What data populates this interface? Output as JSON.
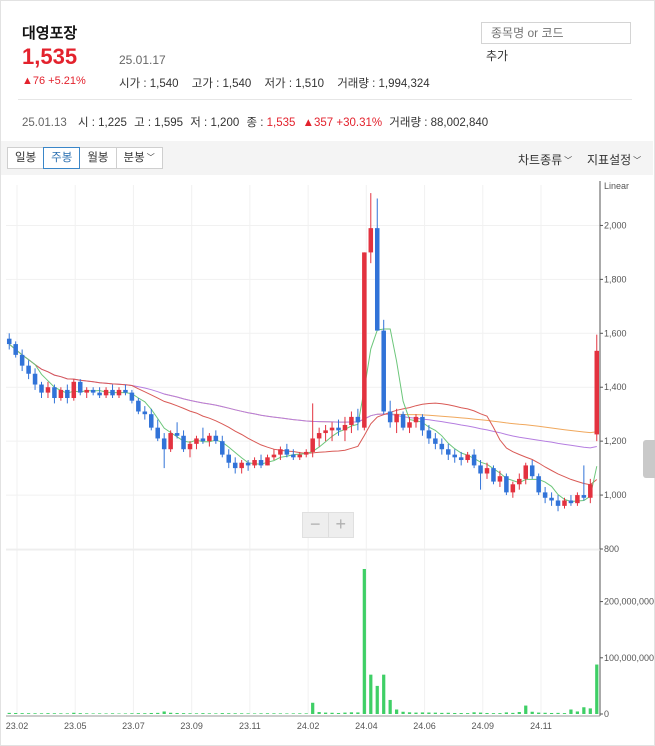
{
  "header": {
    "stock_name": "대영포장",
    "price": "1,535",
    "date": "25.01.17",
    "change": "76 +5.21%",
    "open_label": "시가 : ",
    "open_value": "1,540",
    "high_label": "고가 : ",
    "high_value": "1,540",
    "low_label": "저가 : ",
    "low_value": "1,510",
    "volume_label": "거래량 : ",
    "volume_value": "1,994,324",
    "search_placeholder": "종목명 or 코드",
    "add_label": "추가"
  },
  "weekly": {
    "date": "25.01.13",
    "open_label": "시 : ",
    "open_value": "1,225",
    "high_label": "고 : ",
    "high_value": "1,595",
    "low_label": "저 : ",
    "low_value": "1,200",
    "close_label": "종 : ",
    "close_value": "1,535",
    "change": "357 +30.31%",
    "volume_label": "거래량 : ",
    "volume_value": "88,002,840"
  },
  "toolbar": {
    "tabs": [
      "일봉",
      "주봉",
      "월봉",
      "분봉"
    ],
    "active_tab": "주봉",
    "chart_type": "차트종류",
    "indicator_settings": "지표설정"
  },
  "colors": {
    "up": "#e3323f",
    "down": "#3173d8",
    "ma5": "#6cc67a",
    "ma20": "#d95a56",
    "ma60": "#b57ee0",
    "ma120": "#f0a85d",
    "volume": "#3fcf66"
  },
  "chart_data": {
    "type": "candlestick",
    "scale": "Linear",
    "x_ticks": [
      "23.02",
      "23.05",
      "23.07",
      "23.09",
      "23.11",
      "24.02",
      "24.04",
      "24.06",
      "24.09",
      "24.11"
    ],
    "price_ylim": [
      800,
      2150
    ],
    "price_ticks": [
      800,
      1000,
      1200,
      1400,
      1600,
      1800,
      2000
    ],
    "volume_ylim": [
      0,
      290000000
    ],
    "volume_ticks": [
      0,
      100000000,
      200000000
    ],
    "volume_tick_labels": [
      "0",
      "100,000,000",
      "200,000,000"
    ],
    "candles_ohlc": [
      [
        1580,
        1600,
        1540,
        1560
      ],
      [
        1560,
        1570,
        1510,
        1520
      ],
      [
        1520,
        1540,
        1460,
        1480
      ],
      [
        1480,
        1500,
        1430,
        1450
      ],
      [
        1450,
        1470,
        1390,
        1410
      ],
      [
        1410,
        1420,
        1360,
        1380
      ],
      [
        1380,
        1420,
        1360,
        1400
      ],
      [
        1400,
        1410,
        1340,
        1360
      ],
      [
        1360,
        1400,
        1350,
        1390
      ],
      [
        1390,
        1410,
        1340,
        1360
      ],
      [
        1360,
        1430,
        1350,
        1420
      ],
      [
        1420,
        1430,
        1370,
        1380
      ],
      [
        1380,
        1400,
        1360,
        1390
      ],
      [
        1390,
        1400,
        1370,
        1380
      ],
      [
        1380,
        1400,
        1360,
        1370
      ],
      [
        1370,
        1400,
        1360,
        1390
      ],
      [
        1390,
        1410,
        1360,
        1370
      ],
      [
        1370,
        1400,
        1360,
        1390
      ],
      [
        1390,
        1410,
        1370,
        1380
      ],
      [
        1380,
        1390,
        1340,
        1350
      ],
      [
        1350,
        1360,
        1300,
        1310
      ],
      [
        1310,
        1330,
        1280,
        1300
      ],
      [
        1300,
        1320,
        1240,
        1250
      ],
      [
        1250,
        1280,
        1200,
        1210
      ],
      [
        1210,
        1230,
        1100,
        1170
      ],
      [
        1170,
        1240,
        1160,
        1230
      ],
      [
        1230,
        1270,
        1210,
        1220
      ],
      [
        1220,
        1240,
        1160,
        1170
      ],
      [
        1170,
        1200,
        1140,
        1190
      ],
      [
        1190,
        1220,
        1170,
        1210
      ],
      [
        1210,
        1250,
        1190,
        1200
      ],
      [
        1200,
        1230,
        1180,
        1220
      ],
      [
        1220,
        1240,
        1190,
        1200
      ],
      [
        1200,
        1220,
        1140,
        1150
      ],
      [
        1150,
        1170,
        1100,
        1120
      ],
      [
        1120,
        1140,
        1080,
        1100
      ],
      [
        1100,
        1130,
        1080,
        1120
      ],
      [
        1120,
        1130,
        1090,
        1110
      ],
      [
        1110,
        1140,
        1100,
        1130
      ],
      [
        1130,
        1150,
        1100,
        1110
      ],
      [
        1110,
        1150,
        1110,
        1140
      ],
      [
        1140,
        1170,
        1130,
        1150
      ],
      [
        1150,
        1180,
        1130,
        1170
      ],
      [
        1170,
        1190,
        1140,
        1150
      ],
      [
        1150,
        1170,
        1130,
        1140
      ],
      [
        1140,
        1160,
        1130,
        1150
      ],
      [
        1150,
        1170,
        1140,
        1160
      ],
      [
        1160,
        1340,
        1140,
        1210
      ],
      [
        1210,
        1250,
        1180,
        1230
      ],
      [
        1230,
        1260,
        1200,
        1240
      ],
      [
        1240,
        1270,
        1200,
        1250
      ],
      [
        1250,
        1280,
        1220,
        1240
      ],
      [
        1240,
        1290,
        1200,
        1260
      ],
      [
        1260,
        1310,
        1230,
        1290
      ],
      [
        1290,
        1320,
        1240,
        1270
      ],
      [
        1250,
        1900,
        1240,
        1900
      ],
      [
        1900,
        2120,
        1860,
        1990
      ],
      [
        1990,
        2100,
        1660,
        1610
      ],
      [
        1610,
        1650,
        1300,
        1310
      ],
      [
        1310,
        1350,
        1250,
        1270
      ],
      [
        1270,
        1320,
        1230,
        1300
      ],
      [
        1300,
        1310,
        1240,
        1250
      ],
      [
        1250,
        1290,
        1230,
        1270
      ],
      [
        1270,
        1300,
        1250,
        1290
      ],
      [
        1290,
        1300,
        1220,
        1240
      ],
      [
        1240,
        1260,
        1190,
        1210
      ],
      [
        1210,
        1230,
        1170,
        1190
      ],
      [
        1190,
        1210,
        1150,
        1170
      ],
      [
        1170,
        1190,
        1130,
        1150
      ],
      [
        1150,
        1170,
        1120,
        1140
      ],
      [
        1140,
        1160,
        1110,
        1130
      ],
      [
        1130,
        1160,
        1120,
        1150
      ],
      [
        1150,
        1170,
        1100,
        1110
      ],
      [
        1110,
        1130,
        1020,
        1080
      ],
      [
        1080,
        1120,
        1060,
        1100
      ],
      [
        1100,
        1110,
        1040,
        1050
      ],
      [
        1050,
        1090,
        1030,
        1070
      ],
      [
        1070,
        1080,
        1000,
        1010
      ],
      [
        1010,
        1050,
        990,
        1040
      ],
      [
        1040,
        1080,
        1020,
        1060
      ],
      [
        1060,
        1120,
        1040,
        1110
      ],
      [
        1110,
        1130,
        1060,
        1070
      ],
      [
        1070,
        1080,
        1000,
        1010
      ],
      [
        1010,
        1030,
        970,
        990
      ],
      [
        990,
        1010,
        960,
        980
      ],
      [
        980,
        1000,
        940,
        960
      ],
      [
        960,
        990,
        950,
        980
      ],
      [
        980,
        1000,
        960,
        970
      ],
      [
        970,
        1010,
        960,
        1000
      ],
      [
        1000,
        1110,
        980,
        990
      ],
      [
        990,
        1060,
        970,
        1040
      ],
      [
        1225,
        1595,
        1200,
        1535
      ]
    ],
    "volumes": [
      2000000,
      1800000,
      1500000,
      1400000,
      1300000,
      1200000,
      1500000,
      1300000,
      1200000,
      1100000,
      2200000,
      1500000,
      1200000,
      1000000,
      1100000,
      1000000,
      1200000,
      900000,
      1000000,
      1300000,
      1500000,
      1400000,
      1800000,
      2000000,
      4500000,
      2200000,
      1800000,
      1500000,
      1300000,
      1200000,
      1500000,
      1200000,
      1100000,
      1600000,
      1400000,
      1300000,
      1200000,
      1100000,
      1000000,
      1200000,
      1300000,
      1200000,
      1100000,
      1000000,
      1100000,
      1200000,
      1100000,
      20000000,
      3500000,
      2500000,
      2200000,
      1800000,
      2500000,
      3000000,
      2800000,
      258000000,
      70000000,
      50000000,
      70000000,
      25000000,
      8000000,
      4000000,
      3000000,
      2500000,
      2800000,
      2600000,
      2400000,
      2000000,
      2200000,
      1800000,
      1700000,
      1600000,
      3000000,
      2500000,
      1800000,
      1500000,
      1600000,
      2800000,
      2000000,
      3500000,
      15000000,
      4000000,
      2500000,
      2200000,
      1800000,
      2000000,
      1600000,
      8000000,
      4500000,
      12000000,
      10000000,
      88002840
    ]
  }
}
